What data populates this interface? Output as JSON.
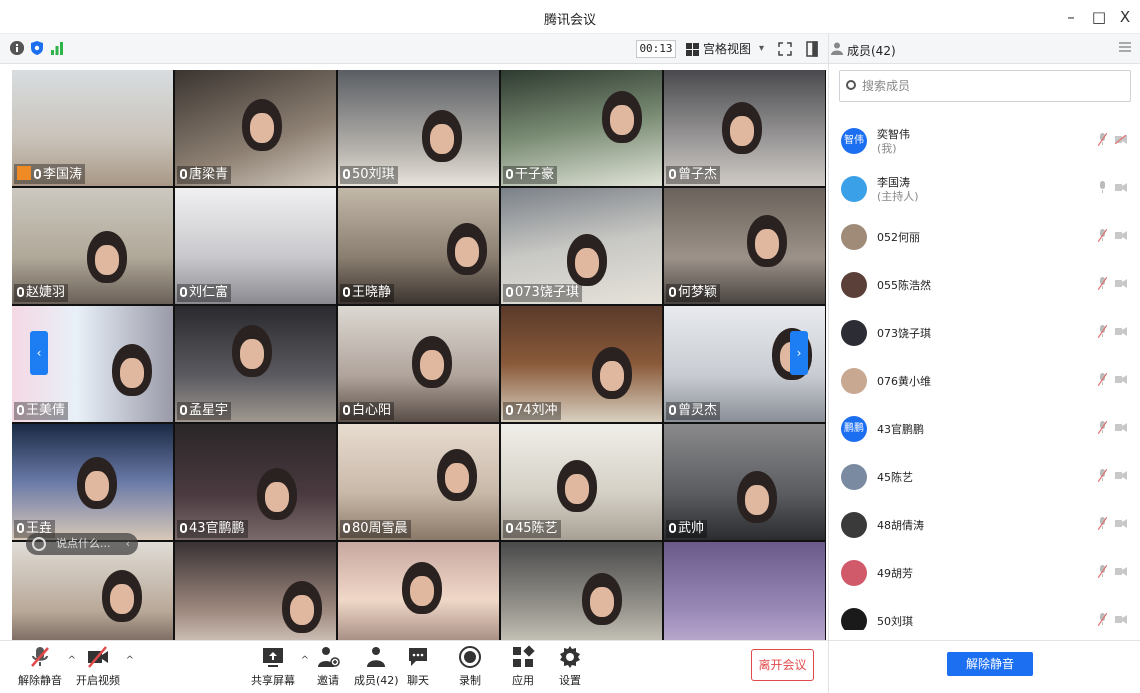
{
  "window": {
    "title": "腾讯会议",
    "minimize": "–",
    "maximize": "□",
    "close": "X"
  },
  "meeting_bar": {
    "timer": "00:13",
    "view_label": "宫格视图",
    "view_caret": "▾",
    "icons": [
      "info-icon",
      "shield-icon",
      "signal-icon",
      "fullscreen-icon",
      "sidepanel-toggle-icon"
    ]
  },
  "tiles": [
    {
      "name": "李国涛",
      "host": true
    },
    {
      "name": "唐梁青"
    },
    {
      "name": "50刘琪"
    },
    {
      "name": "干子豪"
    },
    {
      "name": "曾子杰"
    },
    {
      "name": "赵婕羽"
    },
    {
      "name": "刘仁富"
    },
    {
      "name": "王晓静"
    },
    {
      "name": "073饶子琪"
    },
    {
      "name": "何梦颖"
    },
    {
      "name": "王美倩"
    },
    {
      "name": "孟星宇"
    },
    {
      "name": "白心阳"
    },
    {
      "name": "74刘冲"
    },
    {
      "name": "曾灵杰"
    },
    {
      "name": "王垚"
    },
    {
      "name": "43官鹏鹏"
    },
    {
      "name": "80周雪晨"
    },
    {
      "name": "45陈艺"
    },
    {
      "name": "武帅"
    },
    {
      "name": ""
    },
    {
      "name": ""
    },
    {
      "name": ""
    },
    {
      "name": ""
    },
    {
      "name": ""
    }
  ],
  "chat_placeholder": "说点什么...",
  "chat_collapse": "‹",
  "bottom_tools": {
    "mute": "解除静音",
    "video": "开启视频",
    "share": "共享屏幕",
    "invite": "邀请",
    "members": "成员(42)",
    "chat": "聊天",
    "record": "录制",
    "apps": "应用",
    "settings": "设置",
    "leave": "离开会议",
    "caret": "^"
  },
  "side_panel": {
    "title": "成员(42)",
    "search_placeholder": "搜索成员",
    "unmute_all": "解除静音",
    "members": [
      {
        "name": "奕智伟",
        "sub": "(我)",
        "avatar_text": "智伟",
        "avatar_color": "#1c6ff0"
      },
      {
        "name": "李国涛",
        "sub": "(主持人)",
        "avatar_text": "",
        "avatar_color": "#3aa0e8"
      },
      {
        "name": "052何丽",
        "sub": "",
        "avatar_text": "",
        "avatar_color": "#a08a78"
      },
      {
        "name": "055陈浩然",
        "sub": "",
        "avatar_text": "",
        "avatar_color": "#5a4038"
      },
      {
        "name": "073饶子琪",
        "sub": "",
        "avatar_text": "",
        "avatar_color": "#2c2c34"
      },
      {
        "name": "076黄小维",
        "sub": "",
        "avatar_text": "",
        "avatar_color": "#c8a890"
      },
      {
        "name": "43官鹏鹏",
        "sub": "",
        "avatar_text": "鹏鹏",
        "avatar_color": "#1c6ff0"
      },
      {
        "name": "45陈艺",
        "sub": "",
        "avatar_text": "",
        "avatar_color": "#7a8aa0"
      },
      {
        "name": "48胡倩涛",
        "sub": "",
        "avatar_text": "",
        "avatar_color": "#3a3a3a"
      },
      {
        "name": "49胡芳",
        "sub": "",
        "avatar_text": "",
        "avatar_color": "#d05a6a"
      },
      {
        "name": "50刘琪",
        "sub": "",
        "avatar_text": "",
        "avatar_color": "#1a1a1a"
      }
    ]
  },
  "colors": {
    "accent": "#1c6ff0",
    "danger": "#e04a4a",
    "host_tag": "#f08a24"
  }
}
